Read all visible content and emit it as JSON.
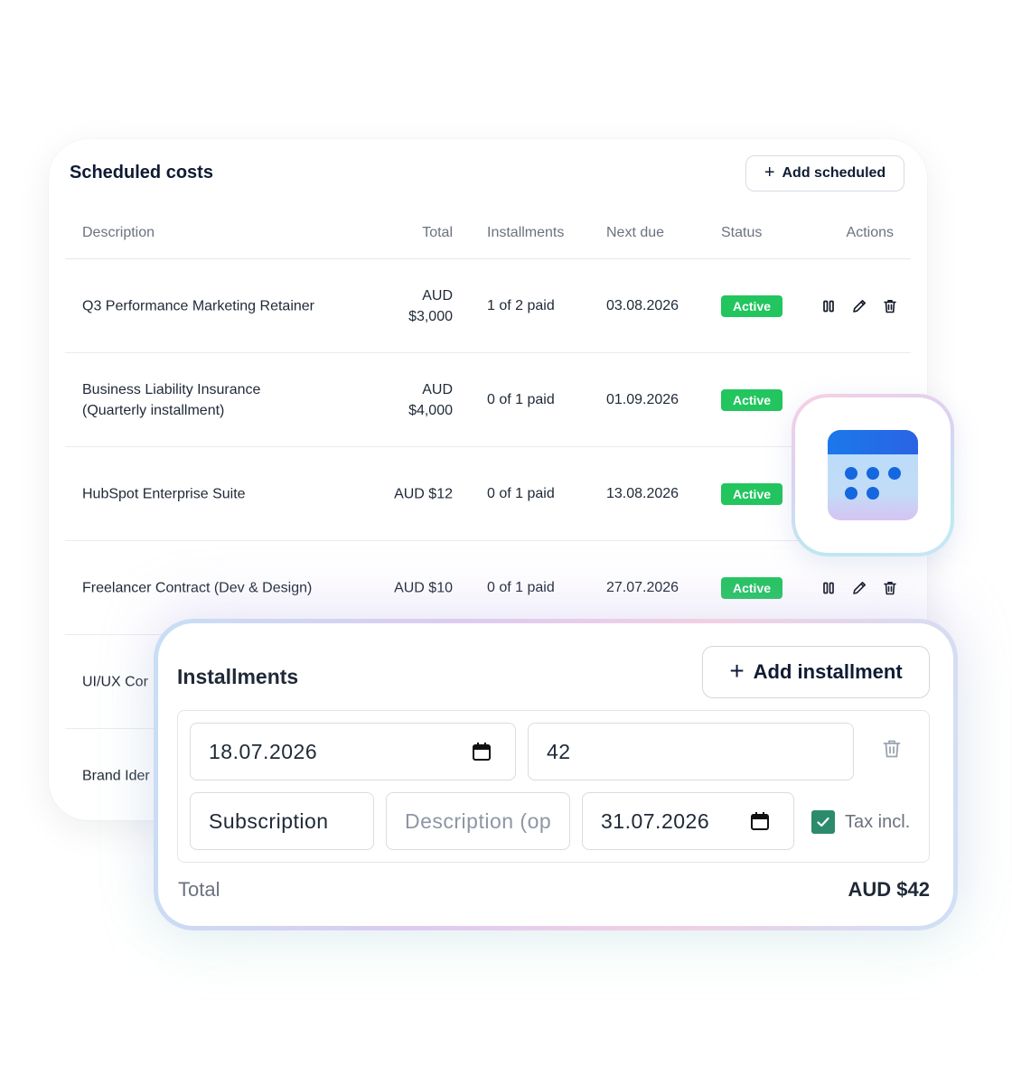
{
  "scheduled": {
    "title": "Scheduled costs",
    "add_button": "Add scheduled",
    "columns": {
      "description": "Description",
      "total": "Total",
      "installments": "Installments",
      "next_due": "Next due",
      "status": "Status",
      "actions": "Actions"
    },
    "rows": [
      {
        "desc_line1": "Q3 Performance Marketing Retainer",
        "desc_line2": "",
        "total_line1": "AUD",
        "total_line2": "$3,000",
        "installments": "1 of 2 paid",
        "next_due": "03.08.2026",
        "status": "Active"
      },
      {
        "desc_line1": "Business Liability Insurance",
        "desc_line2": "(Quarterly installment)",
        "total_line1": "AUD",
        "total_line2": "$4,000",
        "installments": "0 of 1 paid",
        "next_due": "01.09.2026",
        "status": "Active"
      },
      {
        "desc_line1": "HubSpot Enterprise Suite",
        "desc_line2": "",
        "total_line1": "AUD $12",
        "total_line2": "",
        "installments": "0 of 1 paid",
        "next_due": "13.08.2026",
        "status": "Active"
      },
      {
        "desc_line1": "Freelancer Contract (Dev & Design)",
        "desc_line2": "",
        "total_line1": "AUD $10",
        "total_line2": "",
        "installments": "0 of 1 paid",
        "next_due": "27.07.2026",
        "status": "Active"
      },
      {
        "desc_line1": "UI/UX Cor",
        "desc_line2": "",
        "total_line1": "",
        "total_line2": "",
        "installments": "",
        "next_due": "",
        "status": ""
      },
      {
        "desc_line1": "Brand Ider",
        "desc_line2": "",
        "total_line1": "",
        "total_line2": "",
        "installments": "",
        "next_due": "",
        "status": ""
      }
    ]
  },
  "calendar_badge": {
    "icon": "calendar-icon"
  },
  "installments": {
    "title": "Installments",
    "add_button": "Add installment",
    "date_value": "18.07.2026",
    "amount_value": "42",
    "category_value": "Subscription",
    "description_placeholder": "Description (op",
    "due_date_value": "31.07.2026",
    "tax_label": "Tax incl.",
    "tax_checked": true,
    "total_label": "Total",
    "total_value": "AUD $42"
  },
  "colors": {
    "active_badge": "#22c55e",
    "checkbox": "#2c8a6d",
    "calendar_gradient_top": "#1d6fe6",
    "calendar_body": "#bfe0f8"
  }
}
